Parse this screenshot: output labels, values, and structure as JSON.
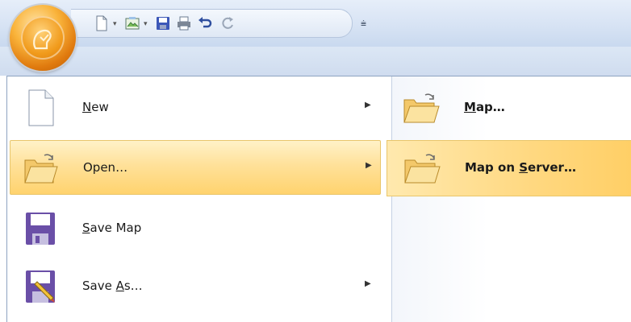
{
  "colors": {
    "highlight": "#ffd880",
    "menu_border": "#8ea3c1",
    "office_orb": "#f19b1c"
  },
  "quick_access": {
    "items": [
      {
        "icon": "new-document-icon",
        "has_dropdown": true
      },
      {
        "icon": "open-map-icon",
        "has_dropdown": true
      },
      {
        "icon": "save-icon",
        "has_dropdown": false
      },
      {
        "icon": "print-icon",
        "has_dropdown": false
      },
      {
        "icon": "undo-icon",
        "has_dropdown": false
      },
      {
        "icon": "redo-icon",
        "has_dropdown": false
      }
    ],
    "customize_glyph": "⩧"
  },
  "menu": {
    "items": [
      {
        "pre": "",
        "mnemonic": "N",
        "post": "ew",
        "icon": "new-document-icon",
        "has_submenu": true
      },
      {
        "pre": "",
        "mnemonic": "",
        "post": "Open…",
        "icon": "open-folder-icon",
        "has_submenu": true,
        "highlighted": true
      },
      {
        "pre": "",
        "mnemonic": "S",
        "post": "ave Map",
        "icon": "save-icon",
        "has_submenu": false
      },
      {
        "pre": "Save ",
        "mnemonic": "A",
        "post": "s…",
        "icon": "save-as-icon",
        "has_submenu": true
      }
    ],
    "submenu": [
      {
        "pre": "",
        "mnemonic": "M",
        "post": "ap…",
        "icon": "open-folder-icon"
      },
      {
        "pre": "Map on ",
        "mnemonic": "S",
        "post": "erver…",
        "icon": "open-folder-icon",
        "highlighted": true
      }
    ],
    "arrow_glyph": "▶"
  }
}
